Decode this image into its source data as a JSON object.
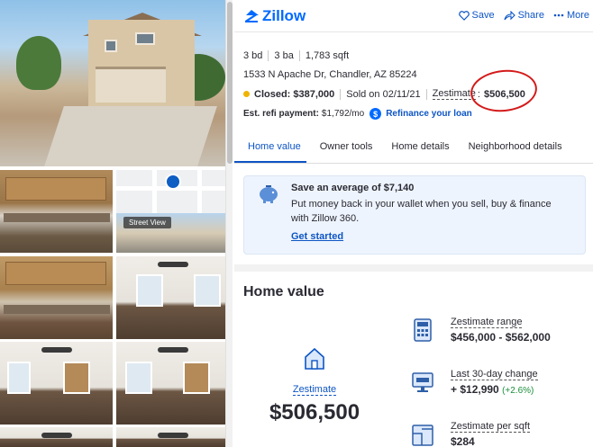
{
  "gallery": {
    "map_overlay_label": "Street View"
  },
  "header": {
    "brand": "Zillow",
    "actions": [
      {
        "label": "Save",
        "icon": "heart-icon"
      },
      {
        "label": "Share",
        "icon": "share-icon"
      },
      {
        "label": "More",
        "icon": "more-icon"
      }
    ]
  },
  "listing": {
    "beds": "3 bd",
    "baths": "3 ba",
    "sqft": "1,783 sqft",
    "address": "1533 N Apache Dr, Chandler, AZ 85224",
    "status_label": "Closed:",
    "closed_price": "$387,000",
    "sold_on": "Sold on 02/11/21",
    "zestimate_label": "Zestimate",
    "zestimate_suffix": ":",
    "zestimate_value": "$506,500",
    "refi_label": "Est. refi payment:",
    "refi_value": "$1,792/mo",
    "refi_link": "Refinance your loan"
  },
  "tabs": [
    {
      "label": "Home value",
      "active": true
    },
    {
      "label": "Owner tools",
      "active": false
    },
    {
      "label": "Home details",
      "active": false
    },
    {
      "label": "Neighborhood details",
      "active": false
    }
  ],
  "promo": {
    "title": "Save an average of $7,140",
    "body": "Put money back in your wallet when you sell, buy & finance with Zillow 360.",
    "cta": "Get started"
  },
  "home_value": {
    "heading": "Home value",
    "zestimate_label": "Zestimate",
    "zestimate_value": "$506,500",
    "stats": [
      {
        "label": "Zestimate range",
        "value": "$456,000 - $562,000",
        "icon": "calculator-icon"
      },
      {
        "label": "Last 30-day change",
        "value": "+ $12,990",
        "change": "(+2.6%)",
        "icon": "monitor-chart-icon"
      },
      {
        "label": "Zestimate per sqft",
        "value": "$284",
        "icon": "floorplan-icon"
      }
    ]
  },
  "colors": {
    "brand_blue": "#006aff",
    "link_blue": "#0d55c5",
    "status_dot": "#f0b400",
    "annotation_red": "#d41a1a",
    "positive_green": "#1a8f3a"
  }
}
